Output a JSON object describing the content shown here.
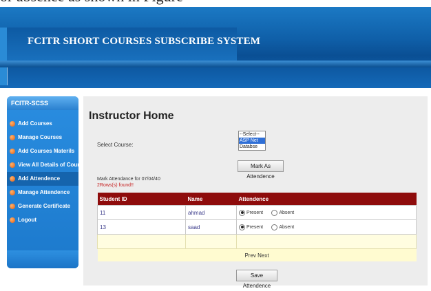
{
  "page": {
    "caption": "or absence as shown in Figure"
  },
  "header": {
    "title": "FCITR SHORT COURSES SUBSCRIBE SYSTEM"
  },
  "sidebar": {
    "heading": "FCITR-SCSS",
    "items": [
      {
        "label": "Add Courses"
      },
      {
        "label": "Manage Courses"
      },
      {
        "label": "Add Courses Materils"
      },
      {
        "label": "View All Details of Courses"
      },
      {
        "label": "Add Attendence",
        "active": true
      },
      {
        "label": "Manage Attendence"
      },
      {
        "label": "Generate Certificate"
      },
      {
        "label": "Logout"
      }
    ]
  },
  "main": {
    "title": "Instructor Home",
    "course_label": "Select Course:",
    "course_options": [
      "--Select--",
      "ASP Net",
      "Databse"
    ],
    "course_selected": "ASP Net",
    "mark_button": "Mark As Attendence",
    "attendance_label": "Mark Attendance for 07/04/40",
    "found_label": "2Rows(s) found!!",
    "table": {
      "headers": [
        "Student ID",
        "Name",
        "Attendence"
      ],
      "rows": [
        {
          "id": "11",
          "name": "ahmad",
          "status": "Present"
        },
        {
          "id": "13",
          "name": "saad",
          "status": "Present"
        }
      ],
      "present_label": "Present",
      "absent_label": "Absent",
      "pager": "Prev Next"
    },
    "save_button": "Save Attendence"
  }
}
